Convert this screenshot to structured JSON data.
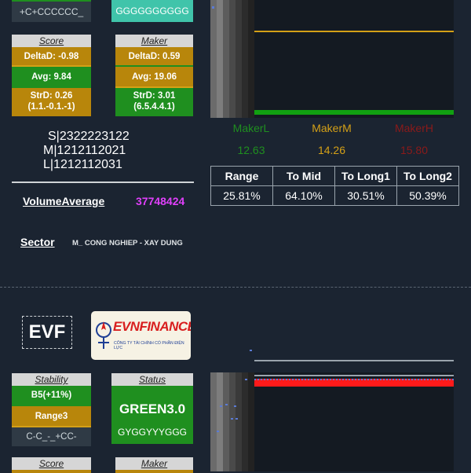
{
  "top_card": {
    "trend_text": "+C+CCCCCC_",
    "status_text": "GGGGGGGGGG",
    "score": {
      "header": "Score",
      "delta": "DeltaD: -0.98",
      "avg": "Avg: 9.84",
      "strd": "StrD: 0.26",
      "strd_detail": "(1.1.-0.1.-1)"
    },
    "maker": {
      "header": "Maker",
      "delta": "DeltaD: 0.59",
      "avg": "Avg: 19.06",
      "strd": "StrD: 3.01",
      "strd_detail": "(6.5.4.4.1)"
    },
    "smk": [
      "S|2322223122",
      "M|1212112021",
      "L|1212112031"
    ],
    "volume_label": "VolumeAverage",
    "volume_value": "37748424",
    "sector_label": "Sector",
    "sector_value": "M_ CONG NGHIEP - XAY DUNG",
    "maker_levels": {
      "labels": [
        "MakerL",
        "MakerM",
        "MakerH"
      ],
      "values": [
        "12.63",
        "14.26",
        "15.80"
      ],
      "colors": [
        "#1f8f1f",
        "#d4a017",
        "#8b1a1a"
      ]
    },
    "range_table": {
      "headers": [
        "Range",
        "To Mid",
        "To Long1",
        "To Long2"
      ],
      "values": [
        "25.81%",
        "64.10%",
        "30.51%",
        "50.39%"
      ]
    }
  },
  "second_card": {
    "ticker": "EVF",
    "logo_text": "EVNFINANCE",
    "logo_subtext": "CÔNG TY TÀI CHÍNH CỔ PHẦN ĐIỆN LỰC",
    "stability": {
      "header": "Stability",
      "value": "B5(+11%)",
      "range": "Range3",
      "trend": "C-C_-_+CC-"
    },
    "status": {
      "header": "Status",
      "value": "GREEN3.0",
      "sequence": "GYGGYYYGGG"
    },
    "score_header": "Score",
    "maker_header": "Maker"
  }
}
